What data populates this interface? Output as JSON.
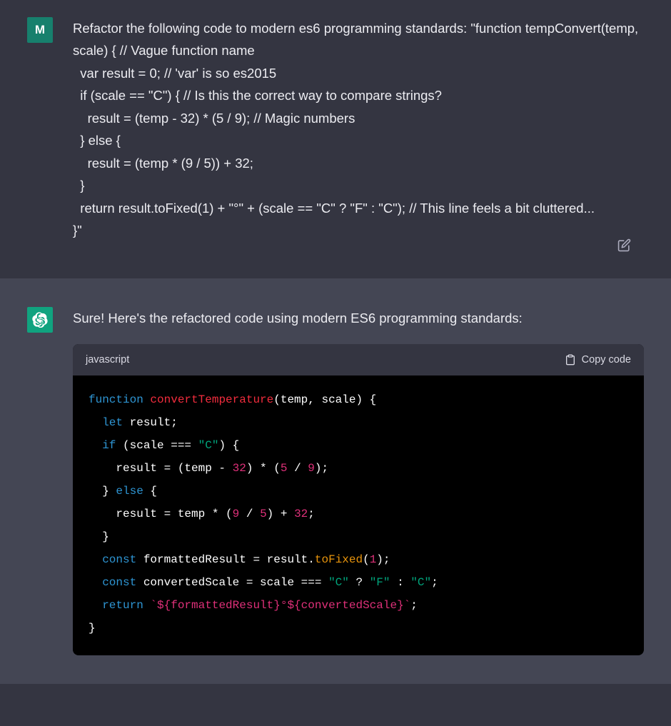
{
  "user": {
    "avatar_letter": "M",
    "message": "Refactor the following code to modern es6 programming standards: \"function tempConvert(temp, scale) { // Vague function name\n  var result = 0; // 'var' is so es2015\n  if (scale == \"C\") { // Is this the correct way to compare strings?\n    result = (temp - 32) * (5 / 9); // Magic numbers\n  } else {\n    result = (temp * (9 / 5)) + 32;\n  }\n  return result.toFixed(1) + \"°\" + (scale == \"C\" ? \"F\" : \"C\"); // This line feels a bit cluttered...\n}\""
  },
  "assistant": {
    "intro": "Sure! Here's the refactored code using modern ES6 programming standards:",
    "code_lang": "javascript",
    "copy_label": "Copy code",
    "code_plain": "function convertTemperature(temp, scale) {\n  let result;\n  if (scale === \"C\") {\n    result = (temp - 32) * (5 / 9);\n  } else {\n    result = temp * (9 / 5) + 32;\n  }\n  const formattedResult = result.toFixed(1);\n  const convertedScale = scale === \"C\" ? \"F\" : \"C\";\n  return `${formattedResult}°${convertedScale}`;\n}",
    "tokens": [
      [
        [
          "function ",
          "kw"
        ],
        [
          "convertTemperature",
          "fn"
        ],
        [
          "(temp, scale) {",
          ""
        ]
      ],
      [
        [
          "  ",
          ""
        ],
        [
          "let",
          " kw"
        ],
        [
          " result;",
          ""
        ]
      ],
      [
        [
          "  ",
          ""
        ],
        [
          "if",
          "kw"
        ],
        [
          " (scale === ",
          ""
        ],
        [
          "\"C\"",
          "str"
        ],
        [
          ") {",
          ""
        ]
      ],
      [
        [
          "    result = (temp - ",
          ""
        ],
        [
          "32",
          "num"
        ],
        [
          ") * (",
          ""
        ],
        [
          "5",
          "num"
        ],
        [
          " / ",
          ""
        ],
        [
          "9",
          "num"
        ],
        [
          ");",
          ""
        ]
      ],
      [
        [
          "  } ",
          ""
        ],
        [
          "else",
          "kw"
        ],
        [
          " {",
          ""
        ]
      ],
      [
        [
          "    result = temp * (",
          ""
        ],
        [
          "9",
          "num"
        ],
        [
          " / ",
          ""
        ],
        [
          "5",
          "num"
        ],
        [
          ") + ",
          ""
        ],
        [
          "32",
          "num"
        ],
        [
          ";",
          ""
        ]
      ],
      [
        [
          "  }",
          ""
        ]
      ],
      [
        [
          "  ",
          ""
        ],
        [
          "const",
          "kw"
        ],
        [
          " formattedResult = result.",
          ""
        ],
        [
          "toFixed",
          "prop"
        ],
        [
          "(",
          ""
        ],
        [
          "1",
          "num"
        ],
        [
          ");",
          ""
        ]
      ],
      [
        [
          "  ",
          ""
        ],
        [
          "const",
          "kw"
        ],
        [
          " convertedScale = scale === ",
          ""
        ],
        [
          "\"C\"",
          "str"
        ],
        [
          " ? ",
          ""
        ],
        [
          "\"F\"",
          "str"
        ],
        [
          " : ",
          ""
        ],
        [
          "\"C\"",
          "str"
        ],
        [
          ";",
          ""
        ]
      ],
      [
        [
          "  ",
          ""
        ],
        [
          "return",
          "kw"
        ],
        [
          " ",
          ""
        ],
        [
          "`${formattedResult}°${convertedScale}`",
          "tpl"
        ],
        [
          ";",
          ""
        ]
      ],
      [
        [
          "}",
          ""
        ]
      ]
    ]
  }
}
